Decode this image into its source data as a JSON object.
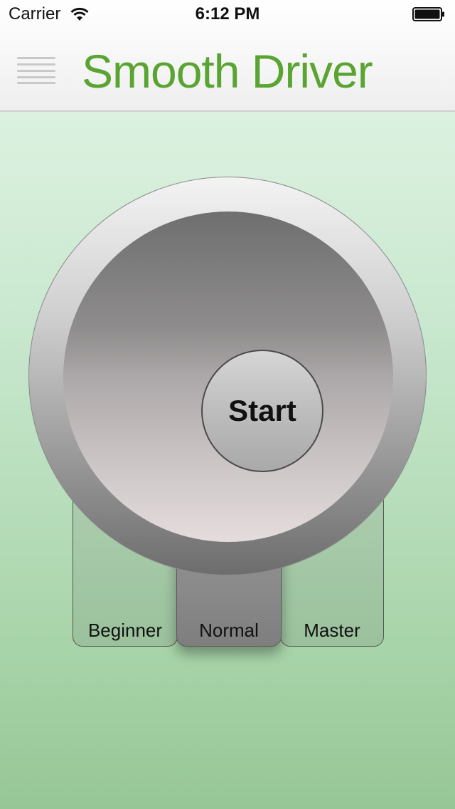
{
  "status_bar": {
    "carrier": "Carrier",
    "time": "6:12 PM",
    "icons": [
      "wifi-icon",
      "battery-icon"
    ]
  },
  "nav": {
    "title": "Smooth Driver",
    "menu_icon": "hamburger-menu-icon",
    "title_color": "#5aa431"
  },
  "dial": {
    "start_label": "Start"
  },
  "modes": {
    "selected": "Normal",
    "items": [
      {
        "label": "Beginner"
      },
      {
        "label": "Normal"
      },
      {
        "label": "Master"
      }
    ]
  },
  "colors": {
    "background_top": "#e6f6e9",
    "background_bottom": "#97c696",
    "selected_tab": "#888888"
  }
}
